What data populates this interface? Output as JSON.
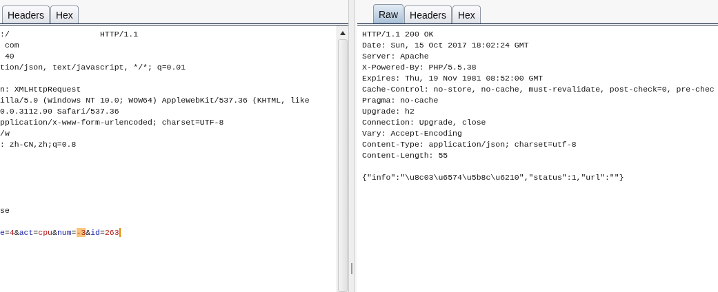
{
  "request": {
    "tabs": [
      {
        "label": "Headers",
        "selected": false
      },
      {
        "label": "Hex",
        "selected": false
      }
    ],
    "lines": [
      {
        "kind": "text",
        "text": ":/                   HTTP/1.1"
      },
      {
        "kind": "text",
        "text": " com"
      },
      {
        "kind": "text",
        "text": " 40"
      },
      {
        "kind": "text",
        "text": "tion/json, text/javascript, */*; q=0.01"
      },
      {
        "kind": "gap"
      },
      {
        "kind": "text",
        "text": "n: XMLHttpRequest"
      },
      {
        "kind": "text",
        "text": "illa/5.0 (Windows NT 10.0; WOW64) AppleWebKit/537.36 (KHTML, like"
      },
      {
        "kind": "text",
        "text": "0.0.3112.90 Safari/537.36"
      },
      {
        "kind": "text",
        "text": "pplication/x-www-form-urlencoded; charset=UTF-8"
      },
      {
        "kind": "text",
        "text": "/w"
      },
      {
        "kind": "text",
        "text": ": zh-CN,zh;q=0.8"
      },
      {
        "kind": "gap"
      },
      {
        "kind": "gap"
      },
      {
        "kind": "gap"
      },
      {
        "kind": "gap"
      },
      {
        "kind": "gap"
      },
      {
        "kind": "text",
        "text": "se"
      },
      {
        "kind": "gap"
      }
    ],
    "params": [
      {
        "kind": "key",
        "text": "e",
        "highlighted": false
      },
      {
        "kind": "sep",
        "text": "=",
        "highlighted": false
      },
      {
        "kind": "value",
        "text": "4",
        "highlighted": false
      },
      {
        "kind": "sep",
        "text": "&",
        "highlighted": false
      },
      {
        "kind": "key",
        "text": "act",
        "highlighted": false
      },
      {
        "kind": "sep",
        "text": "=",
        "highlighted": false
      },
      {
        "kind": "value",
        "text": "cpu",
        "highlighted": false
      },
      {
        "kind": "sep",
        "text": "&",
        "highlighted": false
      },
      {
        "kind": "key",
        "text": "num",
        "highlighted": false
      },
      {
        "kind": "sep",
        "text": "=",
        "highlighted": false
      },
      {
        "kind": "value",
        "text": "-3",
        "highlighted": true
      },
      {
        "kind": "sep",
        "text": "&",
        "highlighted": false
      },
      {
        "kind": "key",
        "text": "id",
        "highlighted": false
      },
      {
        "kind": "sep",
        "text": "=",
        "highlighted": false
      },
      {
        "kind": "value",
        "text": "263",
        "highlighted": false
      }
    ]
  },
  "response": {
    "tabs": [
      {
        "label": "Raw",
        "selected": true
      },
      {
        "label": "Headers",
        "selected": false
      },
      {
        "label": "Hex",
        "selected": false
      }
    ],
    "lines": [
      {
        "kind": "text",
        "text": "HTTP/1.1 200 OK"
      },
      {
        "kind": "text",
        "text": "Date: Sun, 15 Oct 2017 18:02:24 GMT"
      },
      {
        "kind": "text",
        "text": "Server: Apache"
      },
      {
        "kind": "text",
        "text": "X-Powered-By: PHP/5.5.38"
      },
      {
        "kind": "text",
        "text": "Expires: Thu, 19 Nov 1981 08:52:00 GMT"
      },
      {
        "kind": "text",
        "text": "Cache-Control: no-store, no-cache, must-revalidate, post-check=0, pre-chec"
      },
      {
        "kind": "text",
        "text": "Pragma: no-cache"
      },
      {
        "kind": "text",
        "text": "Upgrade: h2"
      },
      {
        "kind": "text",
        "text": "Connection: Upgrade, close"
      },
      {
        "kind": "text",
        "text": "Vary: Accept-Encoding"
      },
      {
        "kind": "text",
        "text": "Content-Type: application/json; charset=utf-8"
      },
      {
        "kind": "text",
        "text": "Content-Length: 55"
      },
      {
        "kind": "gap"
      },
      {
        "kind": "text",
        "text": "{\"info\":\"\\u8c03\\u6574\\u5b8c\\u6210\",\"status\":1,\"url\":\"\"}"
      }
    ]
  }
}
